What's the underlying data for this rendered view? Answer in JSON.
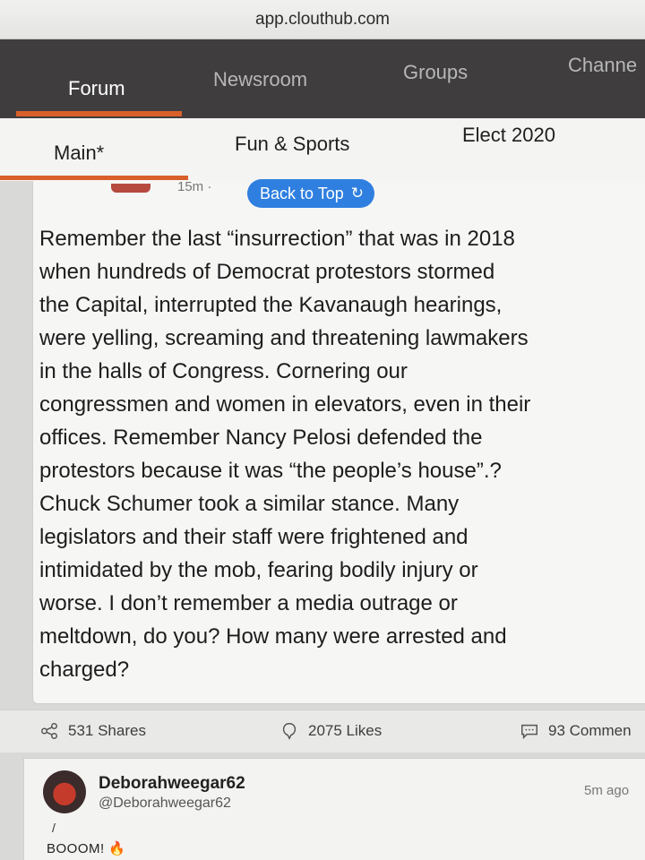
{
  "browser": {
    "url": "app.clouthub.com"
  },
  "nav": {
    "tabs": [
      {
        "label": "Forum"
      },
      {
        "label": "Newsroom"
      },
      {
        "label": "Groups"
      },
      {
        "label": "Channe"
      }
    ]
  },
  "subnav": {
    "tabs": [
      {
        "label": "Main*"
      },
      {
        "label": "Fun & Sports"
      },
      {
        "label": "Elect 2020"
      }
    ]
  },
  "post": {
    "partial_time": "15m ·",
    "back_to_top": "Back to Top",
    "back_to_top_icon": "refresh-icon",
    "text": "Remember the last “insurrection” that was in 2018\nwhen hundreds of Democrat protestors stormed\nthe Capital, interrupted the Kavanaugh hearings,\nwere yelling, screaming and threatening lawmakers\nin the halls of Congress.  Cornering our\ncongressmen and women in elevators, even in their\noffices.  Remember Nancy Pelosi defended the\nprotestors because it was “the people’s house”.?\nChuck Schumer took a similar stance.  Many\nlegislators and their staff were frightened and\nintimidated by the mob, fearing bodily injury or\nworse.  I don’t remember a media outrage or\nmeltdown, do you?  How many were arrested and\ncharged?",
    "actions": {
      "shares": "531 Shares",
      "likes": "2075 Likes",
      "comments": "93  Commen"
    }
  },
  "comment": {
    "name": "Deborahweegar62",
    "handle": "@Deborahweegar62",
    "time": "5m ago",
    "mark": "/",
    "text": "BOOOM! 🔥"
  },
  "colors": {
    "accent": "#d9602a",
    "nav_bg": "#3f3d3e",
    "button_blue": "#2f7fe0"
  }
}
